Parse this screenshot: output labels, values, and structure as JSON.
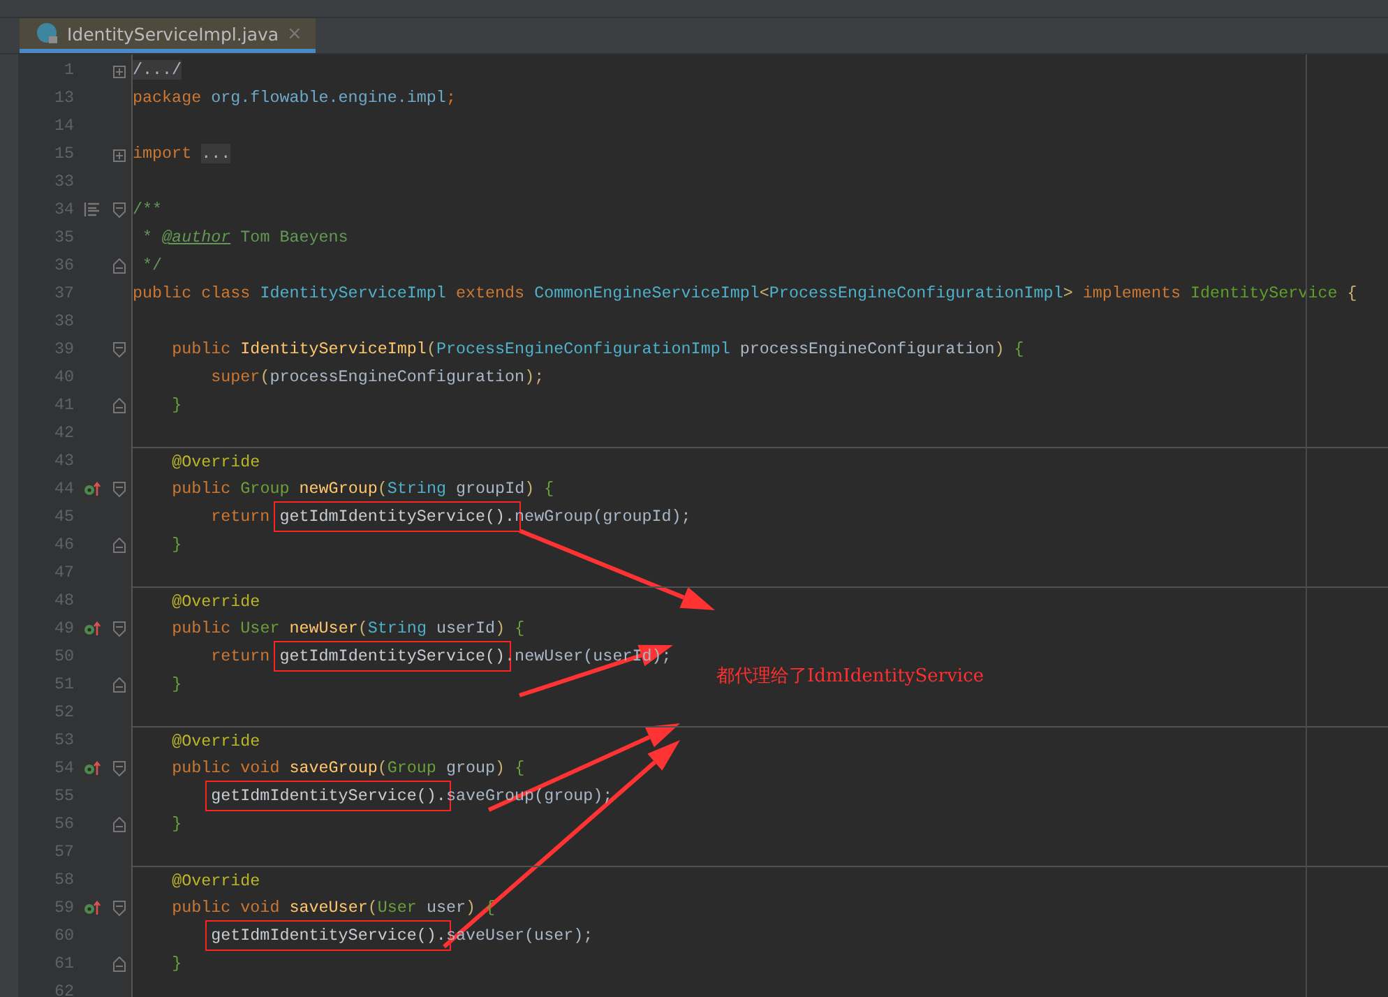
{
  "tab": {
    "title": "IdentityServiceImpl.java",
    "close": "×",
    "selected": true
  },
  "lines": [
    {
      "n": "1",
      "fold": {
        "kind": "plus"
      },
      "tokens": [
        {
          "text": "/.../",
          "kind": "folded"
        }
      ]
    },
    {
      "n": "13",
      "tokens": [
        {
          "text": "package ",
          "kind": "kw"
        },
        {
          "text": "org.flowable.engine.impl",
          "kind": "pkg"
        },
        {
          "text": ";",
          "kind": "kw"
        }
      ]
    },
    {
      "n": "14"
    },
    {
      "n": "15",
      "fold": {
        "kind": "plus"
      },
      "tokens": [
        {
          "text": "import ",
          "kind": "kw"
        },
        {
          "text": "...",
          "kind": "folded"
        }
      ]
    },
    {
      "n": "33"
    },
    {
      "n": "34",
      "fold": {
        "kind": "minus"
      },
      "marker": {
        "kind": "doc"
      },
      "tokens": [
        {
          "text": "/**",
          "kind": "comment"
        }
      ]
    },
    {
      "n": "35",
      "tokens": [
        {
          "text": " * ",
          "kind": "comment"
        },
        {
          "text": "@author",
          "kind": "doctag"
        },
        {
          "text": " Tom Baeyens",
          "kind": "comment"
        }
      ]
    },
    {
      "n": "36",
      "fold": {
        "kind": "end"
      },
      "tokens": [
        {
          "text": " */",
          "kind": "comment"
        }
      ]
    },
    {
      "n": "37",
      "tokens": [
        {
          "text": "public class ",
          "kind": "kw"
        },
        {
          "text": "IdentityServiceImpl",
          "kind": "cls"
        },
        {
          "text": " extends ",
          "kind": "kw"
        },
        {
          "text": "CommonEngineServiceImpl",
          "kind": "cls"
        },
        {
          "text": "<",
          "kind": "punct"
        },
        {
          "text": "ProcessEngineConfigurationImpl",
          "kind": "cls"
        },
        {
          "text": "> ",
          "kind": "punct"
        },
        {
          "text": "implements ",
          "kind": "kw"
        },
        {
          "text": "IdentityService",
          "kind": "iface"
        },
        {
          "text": " {",
          "kind": "punct"
        }
      ]
    },
    {
      "n": "38"
    },
    {
      "n": "39",
      "fold": {
        "kind": "minus"
      },
      "tokens": [
        {
          "text": "    public ",
          "kind": "kw"
        },
        {
          "text": "IdentityServiceImpl",
          "kind": "fn"
        },
        {
          "text": "(",
          "kind": "punct"
        },
        {
          "text": "ProcessEngineConfigurationImpl",
          "kind": "cls"
        },
        {
          "text": " processEngineConfiguration",
          "kind": "param"
        },
        {
          "text": ") ",
          "kind": "punct"
        },
        {
          "text": "{",
          "kind": "brace"
        }
      ]
    },
    {
      "n": "40",
      "tokens": [
        {
          "text": "        super",
          "kind": "kw"
        },
        {
          "text": "(",
          "kind": "punct"
        },
        {
          "text": "processEngineConfiguration",
          "kind": "param"
        },
        {
          "text": ");",
          "kind": "punct"
        }
      ]
    },
    {
      "n": "41",
      "fold": {
        "kind": "end"
      },
      "tokens": [
        {
          "text": "    }",
          "kind": "brace"
        }
      ]
    },
    {
      "n": "42"
    },
    {
      "n": "43",
      "separator": true,
      "tokens": [
        {
          "text": "    @Override",
          "kind": "annot"
        }
      ]
    },
    {
      "n": "44",
      "fold": {
        "kind": "minus"
      },
      "marker": {
        "kind": "override"
      },
      "tokens": [
        {
          "text": "    public ",
          "kind": "kw"
        },
        {
          "text": "Group",
          "kind": "type"
        },
        {
          "text": " newGroup",
          "kind": "fn"
        },
        {
          "text": "(",
          "kind": "punct"
        },
        {
          "text": "String",
          "kind": "cls"
        },
        {
          "text": " groupId",
          "kind": "param"
        },
        {
          "text": ") ",
          "kind": "punct"
        },
        {
          "text": "{",
          "kind": "brace"
        }
      ]
    },
    {
      "n": "45",
      "tokens": [
        {
          "text": "        return ",
          "kind": "kw"
        },
        {
          "text": "getIdmIdentityService().",
          "kind": "boxed"
        },
        {
          "text": "newGroup(groupId);",
          "kind": "plain"
        }
      ]
    },
    {
      "n": "46",
      "fold": {
        "kind": "end"
      },
      "tokens": [
        {
          "text": "    }",
          "kind": "brace"
        }
      ]
    },
    {
      "n": "47"
    },
    {
      "n": "48",
      "separator": true,
      "tokens": [
        {
          "text": "    @Override",
          "kind": "annot"
        }
      ]
    },
    {
      "n": "49",
      "fold": {
        "kind": "minus"
      },
      "marker": {
        "kind": "override"
      },
      "tokens": [
        {
          "text": "    public ",
          "kind": "kw"
        },
        {
          "text": "User",
          "kind": "type"
        },
        {
          "text": " newUser",
          "kind": "fn"
        },
        {
          "text": "(",
          "kind": "punct"
        },
        {
          "text": "String",
          "kind": "cls"
        },
        {
          "text": " userId",
          "kind": "param"
        },
        {
          "text": ") ",
          "kind": "punct"
        },
        {
          "text": "{",
          "kind": "brace"
        }
      ]
    },
    {
      "n": "50",
      "tokens": [
        {
          "text": "        return ",
          "kind": "kw"
        },
        {
          "text": "getIdmIdentityService()",
          "kind": "boxed"
        },
        {
          "text": ".newUser(userId);",
          "kind": "plain"
        }
      ]
    },
    {
      "n": "51",
      "fold": {
        "kind": "end"
      },
      "tokens": [
        {
          "text": "    }",
          "kind": "brace"
        }
      ]
    },
    {
      "n": "52"
    },
    {
      "n": "53",
      "separator": true,
      "tokens": [
        {
          "text": "    @Override",
          "kind": "annot"
        }
      ]
    },
    {
      "n": "54",
      "fold": {
        "kind": "minus"
      },
      "marker": {
        "kind": "override"
      },
      "tokens": [
        {
          "text": "    public void ",
          "kind": "kw"
        },
        {
          "text": "saveGroup",
          "kind": "fn"
        },
        {
          "text": "(",
          "kind": "punct"
        },
        {
          "text": "Group",
          "kind": "type"
        },
        {
          "text": " group",
          "kind": "param"
        },
        {
          "text": ") ",
          "kind": "punct"
        },
        {
          "text": "{",
          "kind": "brace"
        }
      ]
    },
    {
      "n": "55",
      "tokens": [
        {
          "text": "        getIdmIdentityService().",
          "kind": "boxed"
        },
        {
          "text": "saveGroup(group);",
          "kind": "plain"
        }
      ]
    },
    {
      "n": "56",
      "fold": {
        "kind": "end"
      },
      "tokens": [
        {
          "text": "    }",
          "kind": "brace"
        }
      ]
    },
    {
      "n": "57"
    },
    {
      "n": "58",
      "separator": true,
      "tokens": [
        {
          "text": "    @Override",
          "kind": "annot"
        }
      ]
    },
    {
      "n": "59",
      "fold": {
        "kind": "minus"
      },
      "marker": {
        "kind": "override"
      },
      "tokens": [
        {
          "text": "    public void ",
          "kind": "kw"
        },
        {
          "text": "saveUser",
          "kind": "fn"
        },
        {
          "text": "(",
          "kind": "punct"
        },
        {
          "text": "User",
          "kind": "type"
        },
        {
          "text": " user",
          "kind": "param"
        },
        {
          "text": ") ",
          "kind": "punct"
        },
        {
          "text": "{",
          "kind": "brace"
        }
      ]
    },
    {
      "n": "60",
      "tokens": [
        {
          "text": "        getIdmIdentityService().",
          "kind": "boxed"
        },
        {
          "text": "saveUser(user);",
          "kind": "plain"
        }
      ]
    },
    {
      "n": "61",
      "fold": {
        "kind": "end"
      },
      "tokens": [
        {
          "text": "    }",
          "kind": "brace"
        }
      ]
    },
    {
      "n": "62"
    }
  ],
  "note": "都代理给了IdmIdentityService"
}
